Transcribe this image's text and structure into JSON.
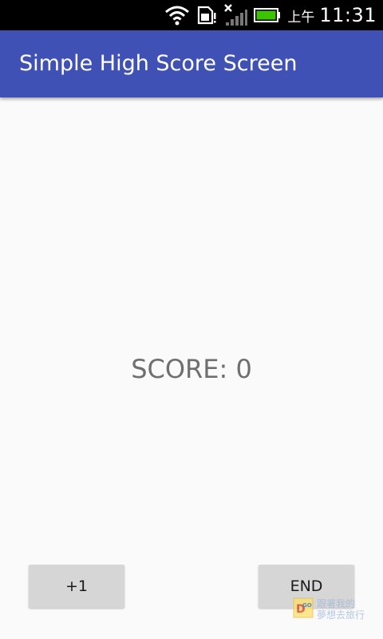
{
  "status_bar": {
    "time": "11:31",
    "ampm": "上午",
    "icons": [
      "wifi-icon",
      "sim-card-icon",
      "signal-icon",
      "battery-icon"
    ],
    "battery_color": "#3cc400"
  },
  "app_bar": {
    "title": "Simple High Score Screen",
    "color": "#3f51b5"
  },
  "main": {
    "score_text": "SCORE: 0"
  },
  "buttons": {
    "increment_label": "+1",
    "end_label": "END"
  },
  "watermark": {
    "logo_text": "GO",
    "line1": "跟著我的",
    "line2": "夢想去旅行"
  }
}
